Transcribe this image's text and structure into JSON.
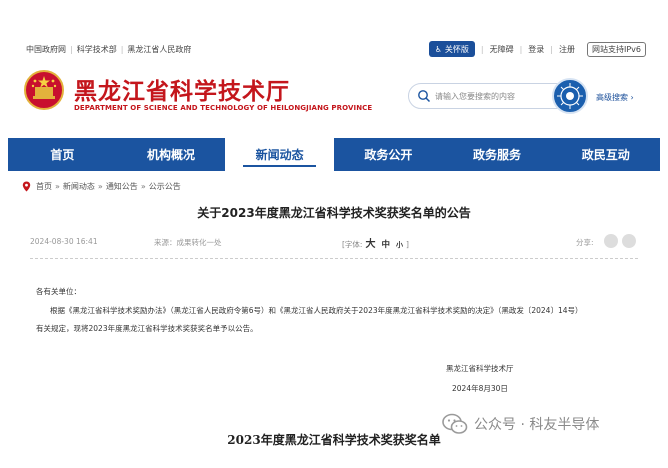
{
  "top_links": [
    "中国政府网",
    "科学技术部",
    "黑龙江省人民政府"
  ],
  "top_right": {
    "care_label": "关怀版",
    "links": [
      "无障碍",
      "登录",
      "注册"
    ],
    "ipv6": "网站支持IPv6"
  },
  "header": {
    "title_cn": "黑龙江省科学技术厅",
    "title_en": "DEPARTMENT OF SCIENCE AND TECHNOLOGY OF HEILONGJIANG PROVINCE",
    "search_placeholder": "请输入您要搜索的内容",
    "advanced_search": "高级搜索"
  },
  "nav": {
    "items": [
      {
        "label": "首页"
      },
      {
        "label": "机构概况"
      },
      {
        "label": "新闻动态"
      },
      {
        "label": "政务公开"
      },
      {
        "label": "政务服务"
      },
      {
        "label": "政民互动"
      }
    ],
    "active": "新闻动态"
  },
  "breadcrumb": [
    "首页",
    "新闻动态",
    "通知公告",
    "公示公告"
  ],
  "article": {
    "title": "关于2023年度黑龙江省科学技术奖获奖名单的公告",
    "date": "2024-08-30 16:41",
    "source": "来源：成果转化一处",
    "font_label": "[字体:",
    "font_big": "大",
    "font_mid": "中",
    "font_small": "小",
    "font_close": "]",
    "share_label": "分享:",
    "salutation": "各有关单位：",
    "line1": "根据《黑龙江省科学技术奖励办法》（黑龙江省人民政府令第6号）和《黑龙江省人民政府关于2023年度黑龙江省科学技术奖励的决定》（黑政发〔2024〕14号）",
    "line2": "有关规定，现将2023年度黑龙江省科学技术奖获奖名单予以公告。",
    "signature": "黑龙江省科学技术厅",
    "sign_date": "2024年8月30日",
    "list_title": "2023年度黑龙江省科学技术奖获奖名单"
  },
  "watermark": "公众号 · 科友半导体",
  "colors": {
    "brand_red": "#c4161c",
    "nav_blue": "#1b54a0"
  }
}
